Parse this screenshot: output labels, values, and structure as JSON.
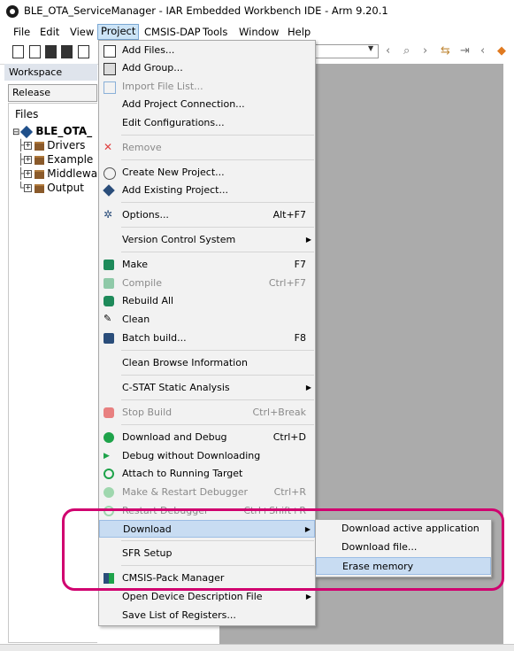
{
  "window": {
    "title": "BLE_OTA_ServiceManager - IAR Embedded Workbench IDE - Arm 9.20.1"
  },
  "menubar": [
    "File",
    "Edit",
    "View",
    "Project",
    "CMSIS-DAP",
    "Tools",
    "Window",
    "Help"
  ],
  "workspace": {
    "header": "Workspace",
    "configuration": "Release",
    "files_label": "Files",
    "project": "BLE_OTA_",
    "folders": [
      "Drivers",
      "Example",
      "Middlewa",
      "Output"
    ]
  },
  "project_menu": [
    {
      "label": "Add Files...",
      "icon": "add-files-icon"
    },
    {
      "label": "Add Group...",
      "icon": "add-group-icon"
    },
    {
      "label": "Import File List...",
      "icon": "import-file-list-icon",
      "disabled": true
    },
    {
      "label": "Add Project Connection..."
    },
    {
      "label": "Edit Configurations..."
    },
    {
      "label": "Remove",
      "icon": "remove-icon",
      "disabled": true
    },
    {
      "label": "Create New Project...",
      "icon": "create-project-icon"
    },
    {
      "label": "Add Existing Project...",
      "icon": "add-project-icon"
    },
    {
      "label": "Options...",
      "shortcut": "Alt+F7",
      "icon": "gear-icon"
    },
    {
      "label": "Version Control System",
      "submenu": true
    },
    {
      "label": "Make",
      "shortcut": "F7",
      "icon": "make-icon"
    },
    {
      "label": "Compile",
      "shortcut": "Ctrl+F7",
      "icon": "compile-icon",
      "disabled": true
    },
    {
      "label": "Rebuild All",
      "icon": "rebuild-icon"
    },
    {
      "label": "Clean",
      "icon": "clean-icon"
    },
    {
      "label": "Batch build...",
      "shortcut": "F8",
      "icon": "batch-build-icon"
    },
    {
      "label": "Clean Browse Information"
    },
    {
      "label": "C-STAT Static Analysis",
      "submenu": true
    },
    {
      "label": "Stop Build",
      "shortcut": "Ctrl+Break",
      "icon": "stop-icon",
      "disabled": true
    },
    {
      "label": "Download and Debug",
      "shortcut": "Ctrl+D",
      "icon": "download-debug-icon"
    },
    {
      "label": "Debug without Downloading",
      "icon": "debug-icon"
    },
    {
      "label": "Attach to Running Target",
      "icon": "attach-icon"
    },
    {
      "label": "Make & Restart Debugger",
      "shortcut": "Ctrl+R",
      "icon": "restart-icon",
      "disabled": true
    },
    {
      "label": "Restart Debugger",
      "shortcut": "Ctrl+Shift+R",
      "icon": "restart-icon",
      "disabled": true
    },
    {
      "label": "Download",
      "submenu": true,
      "highlighted": true
    },
    {
      "label": "SFR Setup"
    },
    {
      "label": "CMSIS-Pack Manager",
      "icon": "cmsis-pack-icon"
    },
    {
      "label": "Open Device Description File",
      "submenu": true
    },
    {
      "label": "Save List of Registers..."
    }
  ],
  "download_submenu": [
    {
      "label": "Download active application"
    },
    {
      "label": "Download file..."
    },
    {
      "label": "Erase memory",
      "highlighted": true
    }
  ],
  "colors": {
    "annotation": "#d0006f",
    "highlight": "#c8dcf2",
    "editor_bg": "#ababab"
  }
}
